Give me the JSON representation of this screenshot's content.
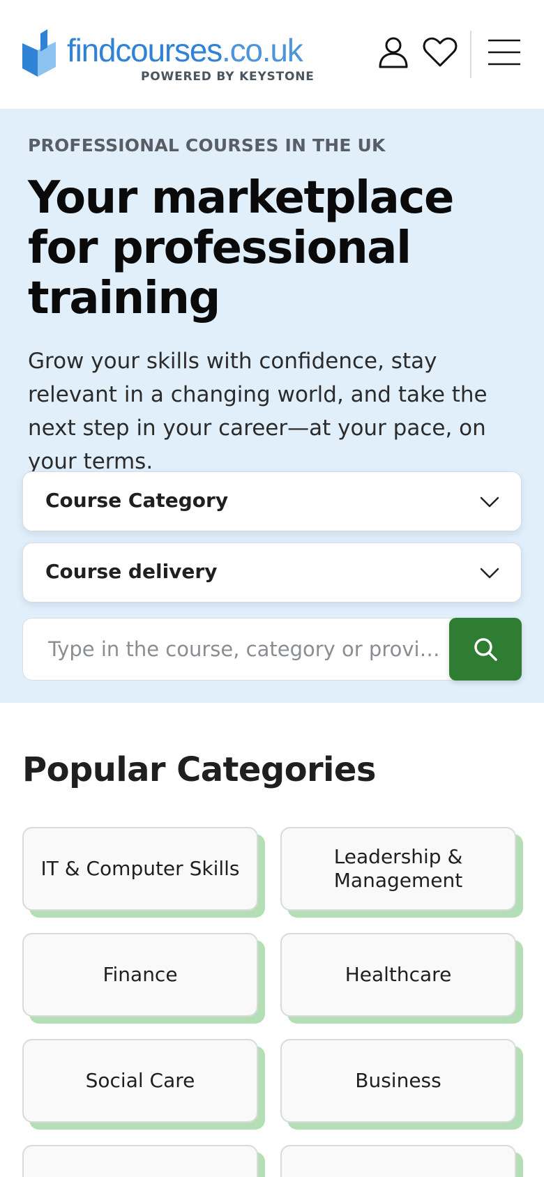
{
  "header": {
    "logo": {
      "name_main": "findcourses",
      "name_tld": ".co.uk",
      "tagline": "POWERED BY KEYSTONE"
    },
    "icons": [
      "user-icon",
      "heart-icon",
      "menu-icon"
    ]
  },
  "hero": {
    "eyebrow": "PROFESSIONAL COURSES IN THE UK",
    "headline": "Your marketplace for professional training",
    "lead": "Grow your skills with confidence, stay relevant in a changing world, and take the next step in your career—at your pace, on your terms.",
    "category_select": "Course Category",
    "delivery_select": "Course delivery",
    "search_placeholder": "Type in the course, category or provi…",
    "background_color": "#e1effb",
    "search_button_color": "#2e7d32"
  },
  "categories": {
    "title": "Popular Categories",
    "items": [
      {
        "label": "IT & Computer Skills"
      },
      {
        "label": "Leadership & Management"
      },
      {
        "label": "Finance"
      },
      {
        "label": "Healthcare"
      },
      {
        "label": "Social Care"
      },
      {
        "label": "Business"
      },
      {
        "label": ""
      },
      {
        "label": ""
      }
    ],
    "accent_shadow_color": "#b4dfb6"
  }
}
